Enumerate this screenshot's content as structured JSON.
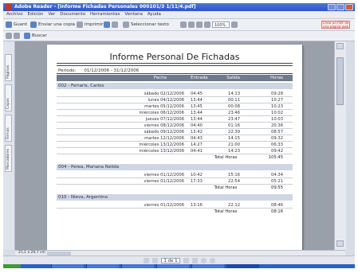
{
  "window": {
    "title": "Adobe Reader - [Informe Fichadas Personales 000101/3 1/11/4.pdf]"
  },
  "menu": [
    "Archivo",
    "Edición",
    "Ver",
    "Documento",
    "Herramientas",
    "Ventana",
    "Ayuda"
  ],
  "toolbar": {
    "save_label": "Guard",
    "email_label": "Enviar una copia",
    "print_label": "Imprimir",
    "select_label": "Seleccionar texto",
    "zoom_value": "100%",
    "search_placeholder": "Crear un PDF de una página web"
  },
  "toolbar2": {
    "find_label": "Buscar"
  },
  "left_tabs": [
    "Páginas",
    "Capas",
    "Firmas",
    "Marcadores"
  ],
  "report": {
    "title": "Informe Personal De Fichadas",
    "period_label": "Período:",
    "period_value": "01/12/2006  -  31/12/2006",
    "columns": [
      "Fecha",
      "Entrada",
      "Salida",
      "Horas"
    ],
    "groups": [
      {
        "name": "002 - Ferraris, Carlos",
        "rows": [
          [
            "sábado 02/12/2006",
            "04:45",
            "14:13",
            "09:28"
          ],
          [
            "lunes 04/12/2006",
            "13:44",
            "00:11",
            "10:27"
          ],
          [
            "martes 05/12/2006",
            "13:45",
            "00:08",
            "10:23"
          ],
          [
            "miércoles 06/12/2006",
            "13:44",
            "23:46",
            "10:02"
          ],
          [
            "jueves 07/12/2006",
            "13:44",
            "23:47",
            "10:03"
          ],
          [
            "viernes 08/12/2006",
            "04:40",
            "01:16",
            "20:36"
          ],
          [
            "sábado 09/12/2006",
            "13:42",
            "22:39",
            "08:57"
          ],
          [
            "martes 12/12/2006",
            "04:43",
            "14:15",
            "09:32"
          ],
          [
            "miércoles 13/12/2006",
            "14:27",
            "21:00",
            "06:33"
          ],
          [
            "miércoles 13/12/2006",
            "04:41",
            "14:23",
            "09:42"
          ]
        ],
        "total_label": "Total Horas",
        "total_value": "105:45"
      },
      {
        "name": "004 - Perea, Mariana Nelida",
        "rows": [
          [
            "viernes 01/12/2006",
            "10:42",
            "15:16",
            "04:34"
          ],
          [
            "viernes 01/12/2006",
            "17:33",
            "22:54",
            "05:21"
          ]
        ],
        "total_label": "Total Horas",
        "total_value": "09:55"
      },
      {
        "name": "010 - Nieva, Argentino",
        "rows": [
          [
            "viernes 01/12/2006",
            "13:16",
            "22:12",
            "08:46"
          ]
        ],
        "total_label": "Total Horas",
        "total_value": "08:16"
      }
    ]
  },
  "status": {
    "page_size": "21,1 x 29,7 cm",
    "page_indicator": "1 de 1"
  },
  "colors": {
    "header_bg": "#6e7a8e",
    "group_bg": "#cfd6e3",
    "titlebar": "#2a56c6"
  }
}
